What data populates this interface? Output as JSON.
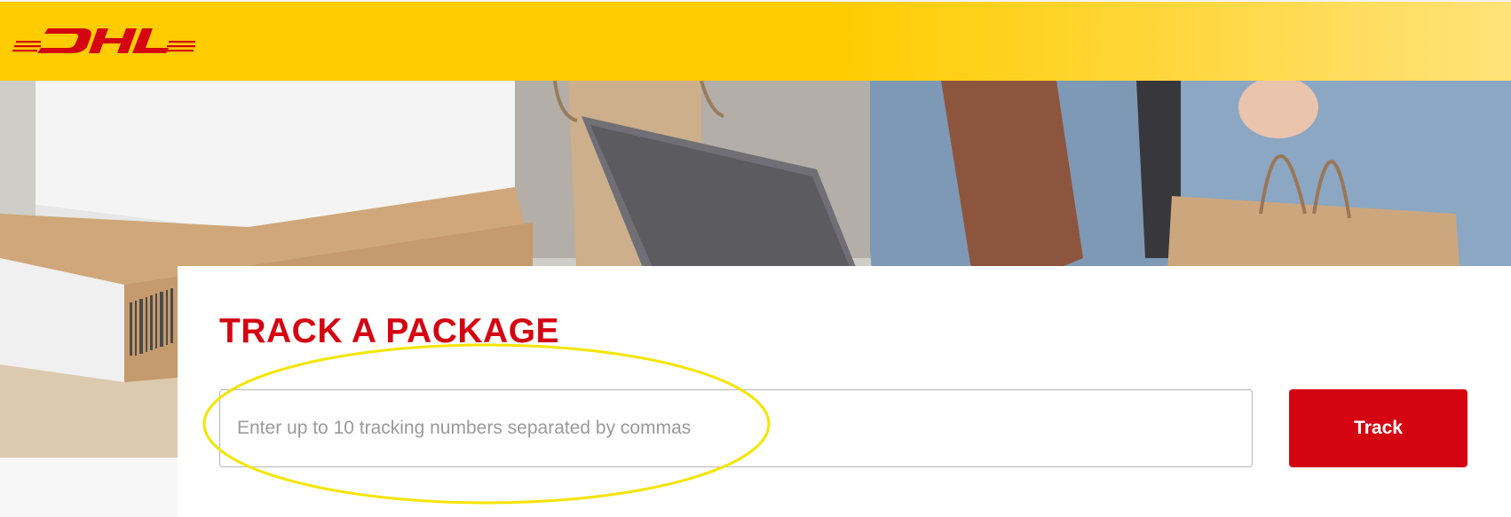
{
  "header": {
    "logo_text": "DHL",
    "brand_color": "#ffcc00",
    "logo_color": "#d40511"
  },
  "hero": {
    "image_description_icon": "hero-photo"
  },
  "track_card": {
    "title": "TRACK A PACKAGE",
    "input_placeholder": "Enter up to 10 tracking numbers separated by commas",
    "input_value": "",
    "button_label": "Track",
    "accent_color": "#d40511"
  },
  "annotation": {
    "shape": "ellipse",
    "color": "#f5e400"
  }
}
